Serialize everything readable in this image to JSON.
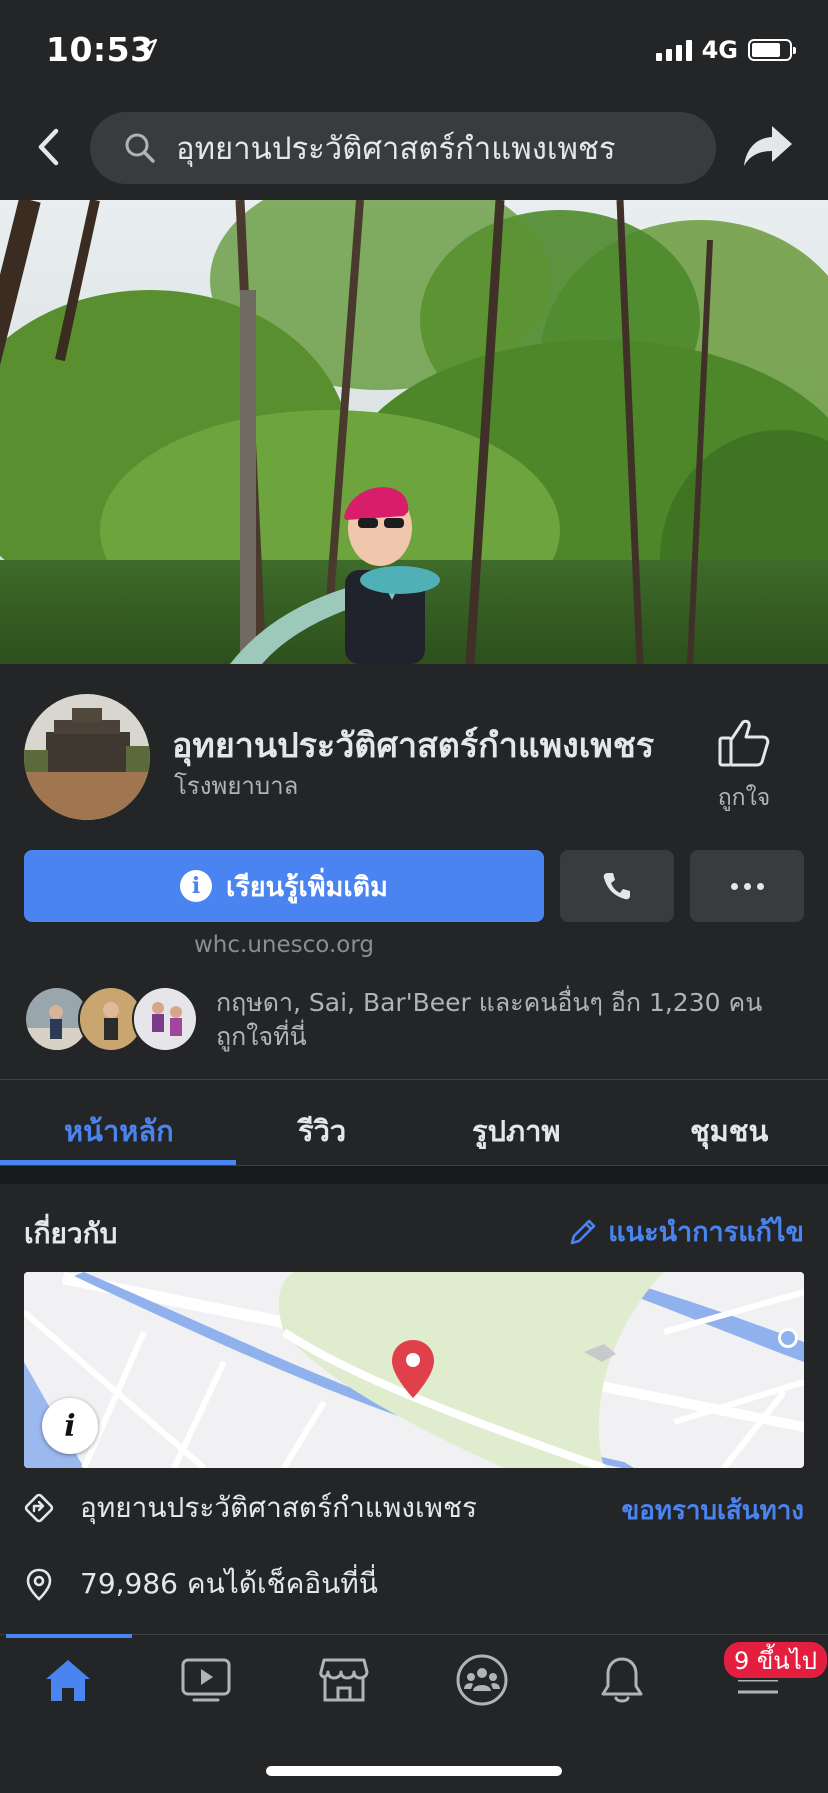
{
  "status_bar": {
    "time": "10:53",
    "network": "4G"
  },
  "header": {
    "search_text": "อุทยานประวัติศาสตร์กำแพงเพชร"
  },
  "profile": {
    "name": "อุทยานประวัติศาสตร์กำแพงเพชร",
    "category": "โรงพยาบาล",
    "like_label": "ถูกใจ",
    "learn_more_label": "เรียนรู้เพิ่มเติม",
    "website": "whc.unesco.org",
    "likes_summary": "กฤษดา, Sai, Bar'Beer และคนอื่นๆ อีก 1,230 คน ถูกใจที่นี่"
  },
  "tabs": [
    {
      "label": "หน้าหลัก",
      "active": true
    },
    {
      "label": "รีวิว",
      "active": false
    },
    {
      "label": "รูปภาพ",
      "active": false
    },
    {
      "label": "ชุมชน",
      "active": false
    }
  ],
  "about": {
    "title": "เกี่ยวกับ",
    "suggest_edit_label": "แนะนำการแก้ไข",
    "address": "อุทยานประวัติศาสตร์กำแพงเพชร",
    "directions_label": "ขอทราบเส้นทาง",
    "checkins": "79,986 คนได้เช็คอินที่นี่"
  },
  "bottom_nav": {
    "items": [
      "home-icon",
      "watch-icon",
      "marketplace-icon",
      "groups-icon",
      "notifications-icon",
      "menu-icon"
    ],
    "badge": "9 ขึ้นไป"
  },
  "colors": {
    "accent": "#4a84f0",
    "background": "#242526",
    "badge": "#e41e3f"
  }
}
